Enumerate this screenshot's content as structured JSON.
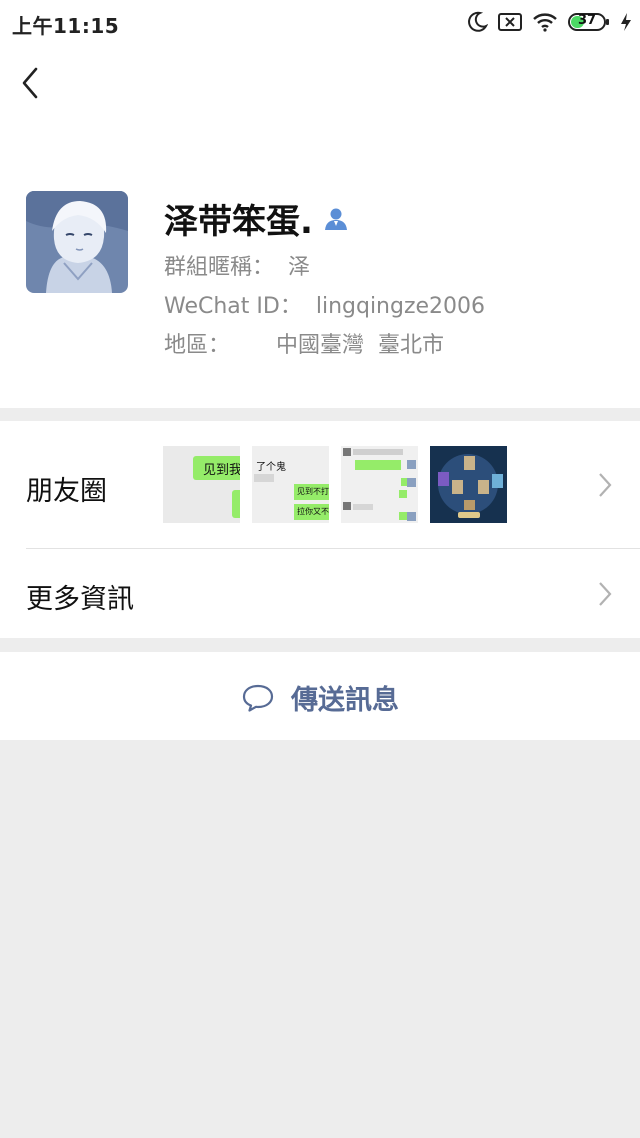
{
  "status_bar": {
    "time": "上午11:15",
    "battery": "37"
  },
  "profile": {
    "name": "泽带笨蛋.",
    "group_nickname_label": "群組暱稱：",
    "group_nickname": "泽",
    "wechat_id_label": "WeChat ID：",
    "wechat_id": "lingqingze2006",
    "region_label": "地區：",
    "region": "中國臺灣  臺北市"
  },
  "rows": {
    "moments_label": "朋友圈",
    "more_info_label": "更多資訊"
  },
  "moments_thumbs": {
    "t1_text": "见到我",
    "t2_text_a": "了个鬼",
    "t2_text_b": "见到不打",
    "t2_text_c": "拉你又不"
  },
  "send_message": {
    "label": "傳送訊息"
  },
  "colors": {
    "accent": "#576b95",
    "background": "#ededed",
    "bubble_green": "#95ec69"
  }
}
